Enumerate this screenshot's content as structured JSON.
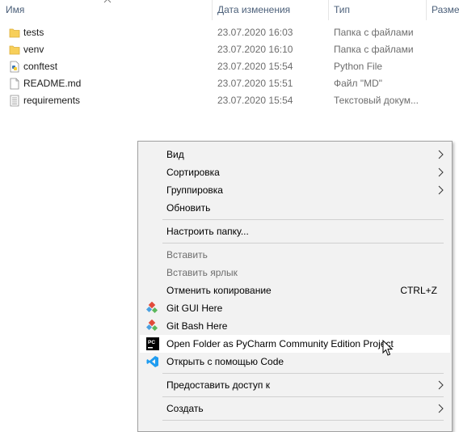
{
  "columns": {
    "name": "Имя",
    "date": "Дата изменения",
    "type": "Тип",
    "size": "Размер"
  },
  "files": [
    {
      "name": "tests",
      "date": "23.07.2020 16:03",
      "type": "Папка с файлами",
      "icon": "folder-icon"
    },
    {
      "name": "venv",
      "date": "23.07.2020 16:10",
      "type": "Папка с файлами",
      "icon": "folder-icon"
    },
    {
      "name": "conftest",
      "date": "23.07.2020 15:54",
      "type": "Python File",
      "icon": "python-file-icon"
    },
    {
      "name": "README.md",
      "date": "23.07.2020 15:51",
      "type": "Файл \"MD\"",
      "icon": "document-icon"
    },
    {
      "name": "requirements",
      "date": "23.07.2020 15:54",
      "type": "Текстовый докум...",
      "icon": "text-document-icon"
    }
  ],
  "context_menu": {
    "view": "Вид",
    "sort": "Сортировка",
    "group": "Группировка",
    "refresh": "Обновить",
    "customize": "Настроить папку...",
    "paste": "Вставить",
    "paste_shortcut": "Вставить ярлык",
    "undo_copy": "Отменить копирование",
    "undo_copy_key": "CTRL+Z",
    "git_gui": "Git GUI Here",
    "git_bash": "Git Bash Here",
    "pycharm": "Open Folder as PyCharm Community Edition Project",
    "vscode": "Открыть с помощью Code",
    "share": "Предоставить доступ к",
    "create": "Создать"
  },
  "colors": {
    "menu_bg": "#f2f2f2",
    "highlight": "#ffffff",
    "folder": "#f7cf5a",
    "vscode": "#1f9cf0"
  }
}
